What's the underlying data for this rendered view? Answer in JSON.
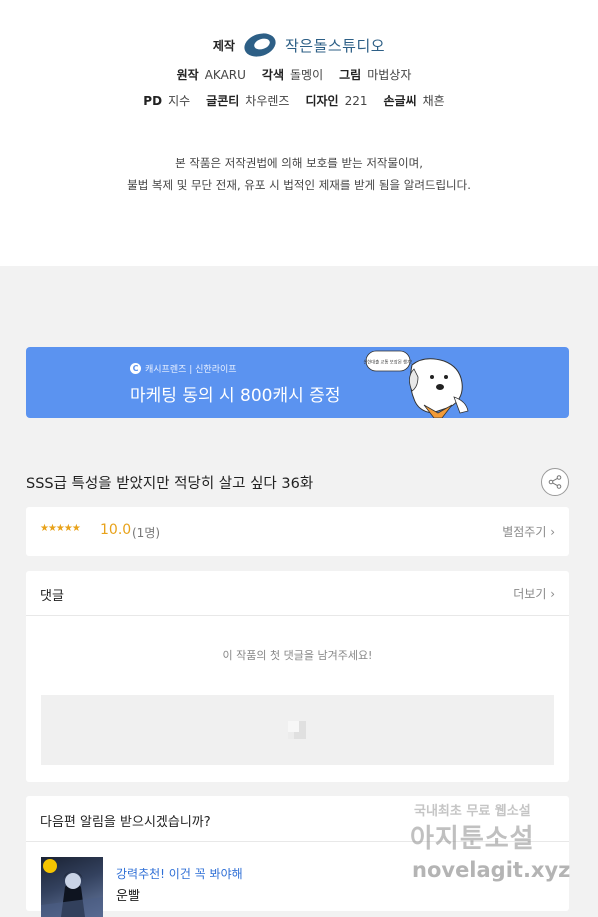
{
  "credits": {
    "studio_label": "제작",
    "studio_name": "작은돌스튜디오",
    "original_label": "원작",
    "original_value": "AKARU",
    "adaptation_label": "각색",
    "adaptation_value": "돌멩이",
    "art_label": "그림",
    "art_value": "마법상자",
    "pd_label": "PD",
    "pd_value": "지수",
    "storyboard_label": "글콘티",
    "storyboard_value": "차우렌즈",
    "design_label": "디자인",
    "design_value": "221",
    "lettering_label": "손글씨",
    "lettering_value": "채흔",
    "notice_line1": "본 작품은 저작권법에 의해 보호를 받는 저작물이며,",
    "notice_line2": "불법 복제 및 무단 전재, 유포 시 법적인 제재를 받게 됨을 알려드립니다."
  },
  "banner": {
    "brand": "캐시프렌즈 | 신한라이프",
    "brand_icon": "C",
    "text": "마케팅 동의 시 800캐시 증정",
    "bubble": "신한대출 교통 보장된 챙겨!",
    "color": "#5b93f0"
  },
  "episode": {
    "title": "SSS급 특성을 받았지만 적당히 살고 싶다 36화"
  },
  "rating": {
    "stars": "★★★★★",
    "score": "10.0",
    "count": "(1명)",
    "rate_button": "별점주기 ›"
  },
  "comments": {
    "title": "댓글",
    "more": "더보기 ›",
    "empty": "이 작품의 첫 댓글을 남겨주세요!"
  },
  "next": {
    "question": "다음편 알림을 받으시겠습니까?",
    "rec_label": "강력추천! 이건 꼭 봐야해",
    "rec_name": "운빨"
  },
  "watermark": {
    "line1": "국내최초 무료 웹소설",
    "line2": "아지툰소설",
    "line3": "novelagit.xyz"
  }
}
